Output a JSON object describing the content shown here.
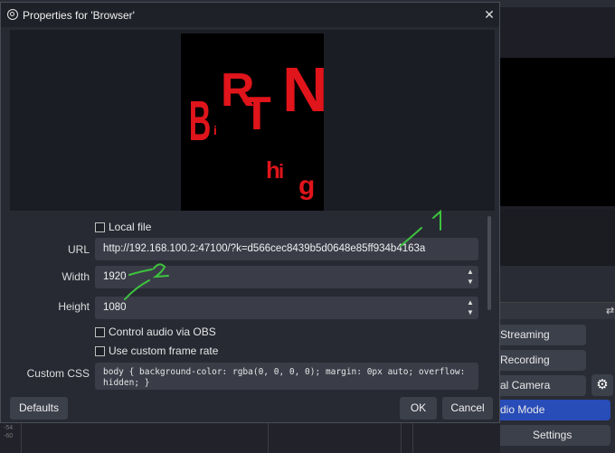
{
  "dialog": {
    "title": "Properties for 'Browser'",
    "close_glyph": "✕"
  },
  "preview": {
    "logo_text": "BiRThiNg"
  },
  "form": {
    "local_file_label": "Local file",
    "url_label": "URL",
    "url_value": "http://192.168.100.2:47100/?k=d566cec8439b5d0648e85ff934b4163a",
    "width_label": "Width",
    "width_value": "1920",
    "height_label": "Height",
    "height_value": "1080",
    "control_audio_label": "Control audio via OBS",
    "custom_frame_rate_label": "Use custom frame rate",
    "custom_css_label": "Custom CSS",
    "custom_css_line1": "body { background-color: rgba(0, 0, 0, 0); margin: 0px auto; overflow:",
    "custom_css_line2": "hidden; }",
    "spin_up": "▲",
    "spin_down": "▼"
  },
  "footer": {
    "defaults": "Defaults",
    "ok": "OK",
    "cancel": "Cancel"
  },
  "annotations": {
    "mark_1": "1",
    "mark_2": "2"
  },
  "controls_dock": {
    "streaming": "Streaming",
    "recording": "Recording",
    "virtual_camera": "al Camera",
    "studio_mode": "dio Mode",
    "settings": "Settings"
  },
  "colors": {
    "accent": "#284cb8",
    "annotation_green": "#3ec43e",
    "logo_red": "#e0141b"
  }
}
